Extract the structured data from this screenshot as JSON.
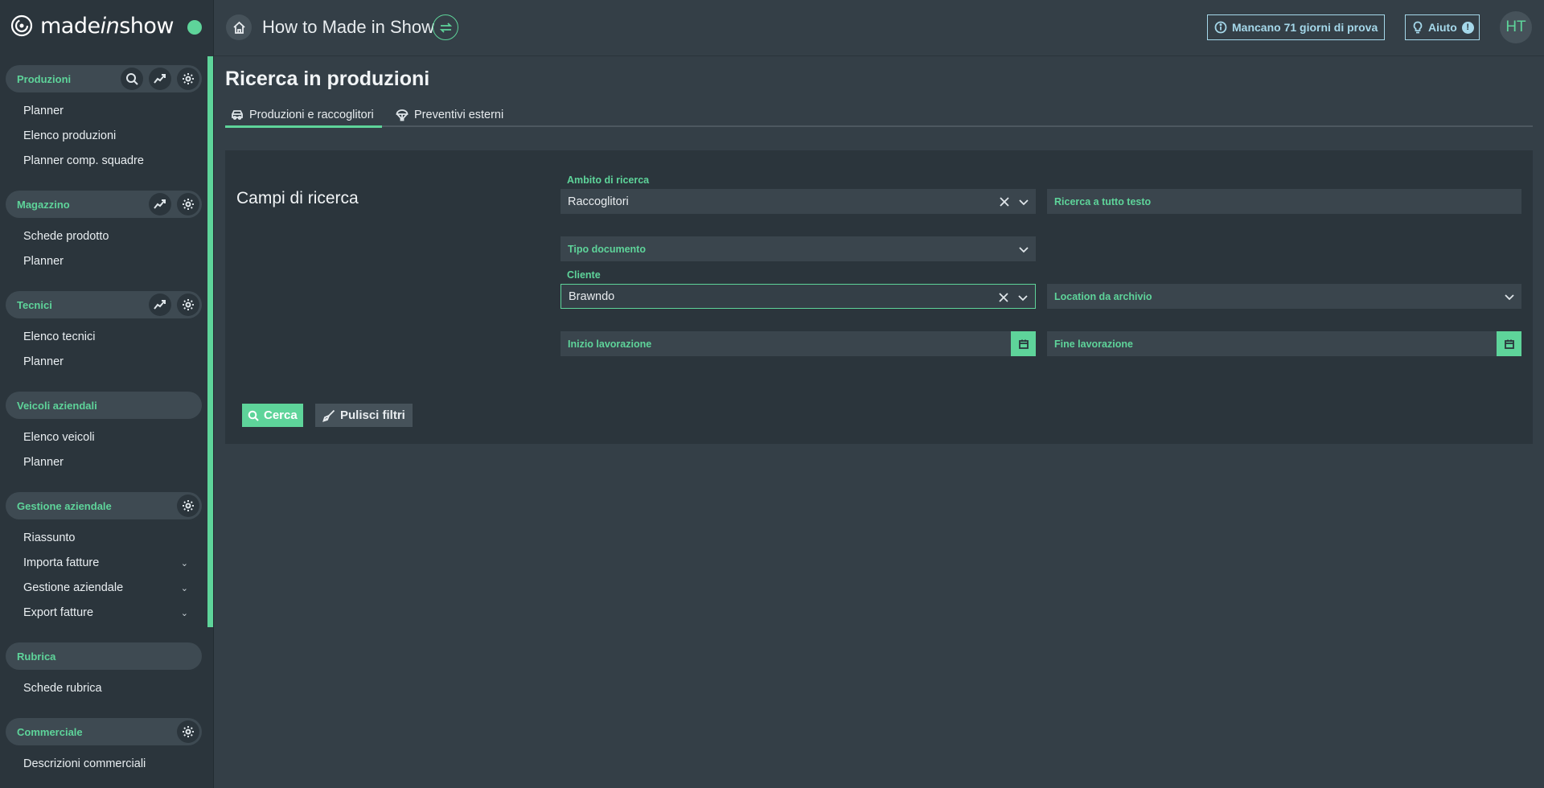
{
  "brand": {
    "name_pre": "made",
    "name_italic": "in",
    "name_post": "show"
  },
  "sidebar": {
    "sections": [
      {
        "title": "Produzioni",
        "items": [
          "Planner",
          "Elenco produzioni",
          "Planner comp. squadre"
        ]
      },
      {
        "title": "Magazzino",
        "items": [
          "Schede prodotto",
          "Planner"
        ]
      },
      {
        "title": "Tecnici",
        "items": [
          "Elenco tecnici",
          "Planner"
        ]
      },
      {
        "title": "Veicoli aziendali",
        "items": [
          "Elenco veicoli",
          "Planner"
        ]
      },
      {
        "title": "Gestione aziendale",
        "items": [
          "Riassunto",
          "Importa fatture",
          "Gestione aziendale",
          "Export fatture"
        ]
      },
      {
        "title": "Rubrica",
        "items": [
          "Schede rubrica"
        ]
      },
      {
        "title": "Commerciale",
        "items": [
          "Descrizioni commerciali"
        ]
      }
    ]
  },
  "topbar": {
    "title": "How to Made in Show",
    "trial": "Mancano 71 giorni di prova",
    "help": "Aiuto",
    "help_badge": "!",
    "avatar": "HT"
  },
  "main": {
    "page_title": "Ricerca in produzioni",
    "tabs": [
      {
        "label": "Produzioni e raccoglitori",
        "icon": "car-icon",
        "active": true
      },
      {
        "label": "Preventivi esterni",
        "icon": "parachute-icon",
        "active": false
      }
    ],
    "panel_title": "Campi di ricerca",
    "fields": {
      "ambito_label": "Ambito di ricerca",
      "ambito_value": "Raccoglitori",
      "fulltext_placeholder": "Ricerca a tutto testo",
      "tipo_documento": "Tipo documento",
      "cliente_label": "Cliente",
      "cliente_value": "Brawndo",
      "location": "Location da archivio",
      "inizio": "Inizio lavorazione",
      "fine": "Fine lavorazione"
    },
    "buttons": {
      "search": "Cerca",
      "clear": "Pulisci filtri"
    }
  },
  "colors": {
    "accent": "#5ed49a",
    "info": "#a5d8ea",
    "background": "#343f47",
    "sidebar": "#2b353c"
  }
}
